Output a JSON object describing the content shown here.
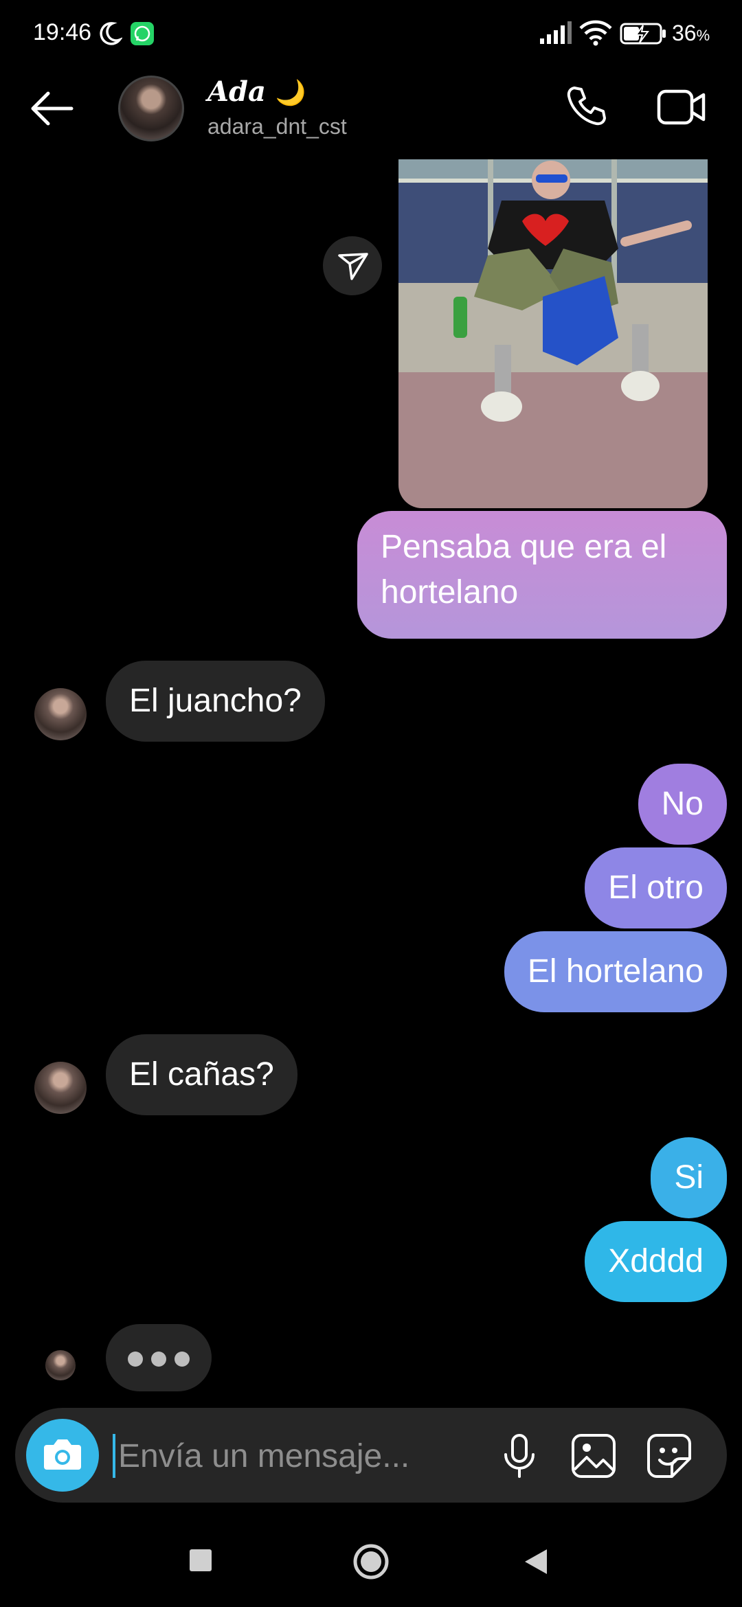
{
  "status_bar": {
    "time": "19:46",
    "battery_value": "36",
    "battery_unit": "%"
  },
  "header": {
    "name": "Ada",
    "name_emoji": "🌙",
    "username": "adara_dnt_cst"
  },
  "messages": [
    {
      "side": "out",
      "text": "Pensaba que era el hortelano"
    },
    {
      "side": "in",
      "text": "El juancho?"
    },
    {
      "side": "out",
      "text": "No"
    },
    {
      "side": "out",
      "text": "El otro"
    },
    {
      "side": "out",
      "text": "El hortelano"
    },
    {
      "side": "in",
      "text": "El cañas?"
    },
    {
      "side": "out",
      "text": "Si"
    },
    {
      "side": "out",
      "text": "Xdddd"
    }
  ],
  "composer": {
    "placeholder": "Envía un mensaje..."
  },
  "icons": {
    "back": "arrow-left-icon",
    "call": "phone-icon",
    "video": "video-camera-icon",
    "share": "send-icon",
    "camera": "camera-icon",
    "mic": "microphone-icon",
    "gallery": "image-icon",
    "sticker": "sticker-icon"
  },
  "colors": {
    "outgoing_top": "#c88cd6",
    "outgoing_bottom": "#2fb7e8",
    "incoming": "#262626",
    "accent": "#35b8e8"
  }
}
